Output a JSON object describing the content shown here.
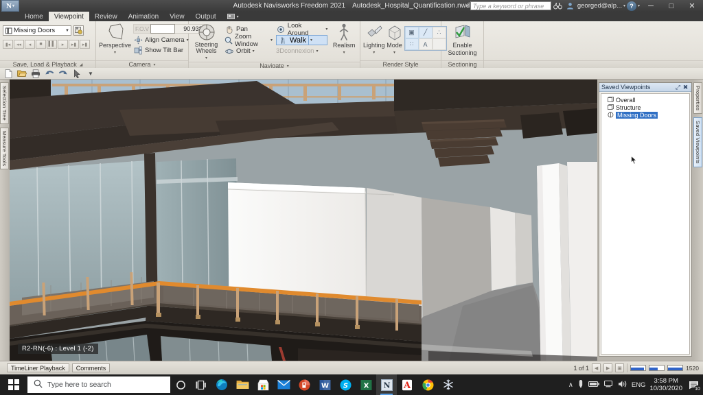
{
  "window": {
    "app_title": "Autodesk Navisworks Freedom 2021",
    "file_name": "Autodesk_Hospital_Quantification.nwd",
    "logo_text": "N",
    "minimize": "─",
    "maximize": "□",
    "close": "✕",
    "help_label": "?",
    "search_placeholder": "Type a keyword or phrase",
    "user_label": "georged@alp...",
    "icons": {
      "search": "binoculars-icon",
      "user": "user-icon",
      "help": "help-icon"
    }
  },
  "ribbon": {
    "tabs": [
      {
        "label": "Home",
        "active": false
      },
      {
        "label": "Viewpoint",
        "active": true
      },
      {
        "label": "Review",
        "active": false
      },
      {
        "label": "Animation",
        "active": false
      },
      {
        "label": "View",
        "active": false
      },
      {
        "label": "Output",
        "active": false
      }
    ],
    "extra_tab_icon": "render-tab-icon",
    "panels": {
      "save_load_playback": {
        "title": "Save, Load & Playback",
        "viewpoint_value": "Missing Doors",
        "save_viewpoint_icon": "save-viewpoint-icon",
        "playback_buttons": [
          "first-frame",
          "rewind",
          "step-back",
          "stop",
          "pause",
          "play",
          "step-forward",
          "last-frame"
        ]
      },
      "camera": {
        "title": "Camera",
        "perspective_label": "Perspective",
        "fov_label": "F.O.V",
        "fov_value": "90.938",
        "fov_unit": "°",
        "align_camera_label": "Align Camera",
        "show_tilt_bar_label": "Show Tilt Bar"
      },
      "navigate": {
        "title": "Navigate",
        "steering_wheels_label": "Steering Wheels",
        "pan_label": "Pan",
        "zoom_window_label": "Zoom Window",
        "orbit_label": "Orbit",
        "look_around_label": "Look Around",
        "walk_label": "Walk",
        "connexion_label": "3Dconnexion",
        "realism_label": "Realism",
        "active_tool": "Walk"
      },
      "render_style": {
        "title": "Render Style",
        "lighting_label": "Lighting",
        "mode_label": "Mode",
        "toggles": [
          {
            "name": "surfaces-toggle",
            "glyph": "▣",
            "on": true
          },
          {
            "name": "lines-toggle",
            "glyph": "╱",
            "on": true
          },
          {
            "name": "points-toggle",
            "glyph": "∴",
            "on": false
          },
          {
            "name": "snap-points-toggle",
            "glyph": "∷",
            "on": true
          },
          {
            "name": "text-toggle",
            "glyph": "A",
            "on": false
          }
        ]
      },
      "sectioning": {
        "title": "Sectioning",
        "enable_label_line1": "Enable",
        "enable_label_line2": "Sectioning"
      }
    }
  },
  "quick_access": {
    "items": [
      {
        "name": "new-icon",
        "glyph": "⬜"
      },
      {
        "name": "open-icon",
        "glyph": "📂"
      },
      {
        "name": "print-icon",
        "glyph": "⎙"
      },
      {
        "name": "undo-icon",
        "glyph": "↶"
      },
      {
        "name": "redo-icon",
        "glyph": "↷"
      },
      {
        "name": "select-icon",
        "glyph": "➤"
      },
      {
        "name": "customize-icon",
        "glyph": "▾"
      }
    ]
  },
  "left_tabs": [
    {
      "label": "Selection Tree"
    },
    {
      "label": "Measure Tools"
    }
  ],
  "right_tabs": [
    {
      "label": "Properties",
      "active": false
    },
    {
      "label": "Saved Viewpoints",
      "active": true
    }
  ],
  "saved_viewpoints_panel": {
    "title": "Saved Viewpoints",
    "float_icon": "float-icon",
    "close_icon": "close-icon",
    "items": [
      {
        "label": "Overall",
        "selected": false
      },
      {
        "label": "Structure",
        "selected": false
      },
      {
        "label": "Missing Doors",
        "selected": true
      }
    ]
  },
  "viewport": {
    "object_label": "R2-RN(-6) : Level 1 (-2)",
    "colors": {
      "sky": "#a9bfcf",
      "beam_dark": "#3b332e",
      "beam_mid": "#5a4b42",
      "glass": "#93a3a6",
      "rail_wood": "#c9a278",
      "rail_orange": "#e08a2e",
      "wall_white": "#f4f3f1",
      "floor_gray": "#8d8d8d",
      "deck_dark": "#2e2823",
      "slab_gray": "#b6b3ae"
    }
  },
  "bottom_bar": {
    "tabs": [
      {
        "label": "TimeLiner Playback"
      },
      {
        "label": "Comments"
      }
    ],
    "page_indicator": "1 of 1",
    "memory_value": "1520",
    "nav_buttons": [
      "prev-page",
      "next-page",
      "page-view"
    ]
  },
  "taskbar": {
    "search_placeholder": "Type here to search",
    "search_icon": "search-icon",
    "start_icon": "windows-start-icon",
    "cortana_icon": "cortana-icon",
    "taskview_icon": "task-view-icon",
    "apps": [
      {
        "name": "edge-icon",
        "active": false
      },
      {
        "name": "file-explorer-icon",
        "active": false
      },
      {
        "name": "microsoft-store-icon",
        "active": false
      },
      {
        "name": "mail-icon",
        "active": false
      },
      {
        "name": "powerpoint-icon",
        "active": false
      },
      {
        "name": "word-icon",
        "active": false
      },
      {
        "name": "skype-icon",
        "active": false
      },
      {
        "name": "excel-icon",
        "active": false
      },
      {
        "name": "navisworks-icon",
        "active": true
      },
      {
        "name": "acrobat-reader-icon",
        "active": false
      },
      {
        "name": "chrome-icon",
        "active": false
      },
      {
        "name": "snowflake-icon",
        "active": false
      }
    ],
    "tray": {
      "chevron": "∧",
      "language": "ENG",
      "time": "3:58 PM",
      "date": "10/30/2020",
      "notification_count": "10",
      "icons": [
        "pen-icon",
        "battery-icon",
        "network-icon",
        "volume-icon"
      ]
    }
  }
}
